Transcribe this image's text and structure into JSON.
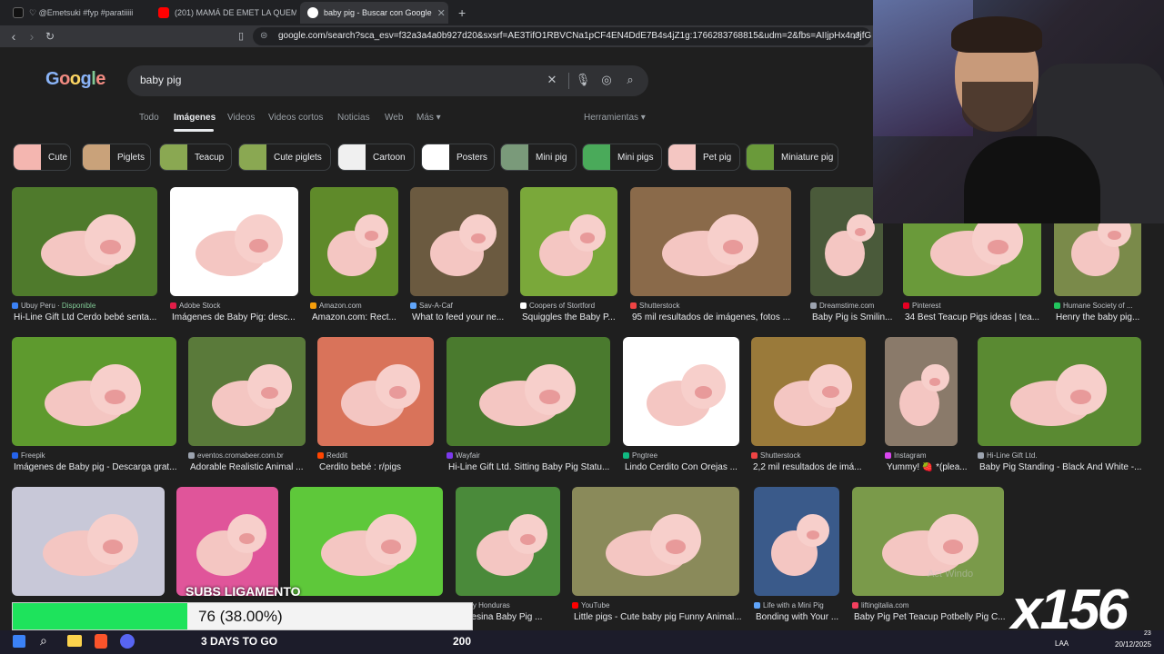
{
  "browser": {
    "tabs": [
      {
        "label": "♡ @Emetsuki #fyp #paratiiiii",
        "favicon_color": "#ffffff"
      },
      {
        "label": "(201) MAMÁ DE EMET LA QUEMA EN",
        "favicon_color": "#ff0000"
      },
      {
        "label": "baby pig - Buscar con Google",
        "favicon_color": "#ffffff",
        "active": true
      }
    ],
    "url": "google.com/search?sca_esv=f32a3a4a0b927d20&sxsrf=AE3TifO1RBVCNa1pCF4EN4DdE7B4s4jZ1g:1766283768815&udm=2&fbs=AIIjpHx4nJjfGojPV..."
  },
  "search": {
    "logo": "Google",
    "query": "baby pig"
  },
  "nav_tabs": [
    {
      "label": "Todo"
    },
    {
      "label": "Imágenes",
      "active": true
    },
    {
      "label": "Videos"
    },
    {
      "label": "Videos cortos"
    },
    {
      "label": "Noticias"
    },
    {
      "label": "Web"
    },
    {
      "label": "Más ▾"
    }
  ],
  "tools_label": "Herramientas ▾",
  "chips": [
    "Cute",
    "Piglets",
    "Teacup",
    "Cute piglets",
    "Cartoon",
    "Posters",
    "Mini pig",
    "Mini pigs",
    "Pet pig",
    "Miniature pig"
  ],
  "results": [
    {
      "source": "Ubuy Peru",
      "availability": "Disponible",
      "title": "Hi-Line Gift Ltd Cerdo bebé senta...",
      "bg": "#4f7a2c",
      "src_color": "#3b82f6"
    },
    {
      "source": "Adobe Stock",
      "title": "Imágenes de Baby Pig: desc...",
      "bg": "#ffffff",
      "src_color": "#e11d48"
    },
    {
      "source": "Amazon.com",
      "title": "Amazon.com: Rect...",
      "bg": "#5f8a2a",
      "src_color": "#f59e0b"
    },
    {
      "source": "Sav-A-Caf",
      "title": "What to feed your ne...",
      "bg": "#6b5a40",
      "src_color": "#60a5fa"
    },
    {
      "source": "Coopers of Stortford",
      "title": "Squiggles the Baby P...",
      "bg": "#7aa83a",
      "src_color": "#ffffff"
    },
    {
      "source": "Shutterstock",
      "title": "95 mil resultados de imágenes, fotos ...",
      "bg": "#8a6a4a",
      "src_color": "#ef4444"
    },
    {
      "source": "Dreamstime.com",
      "title": "Baby Pig is Smilin...",
      "bg": "#4a5a3a",
      "src_color": "#9ca3af"
    },
    {
      "source": "Pinterest",
      "title": "34 Best Teacup Pigs ideas | tea...",
      "bg": "#6a9a3a",
      "src_color": "#e60023"
    },
    {
      "source": "Humane Society of ...",
      "title": "Henry the baby pig...",
      "bg": "#7a8a4a",
      "src_color": "#22c55e"
    },
    {
      "source": "Freepik",
      "title": "Imágenes de Baby pig - Descarga grat...",
      "bg": "#5e9a2e",
      "src_color": "#2563eb"
    },
    {
      "source": "eventos.cromabeer.com.br",
      "title": "Adorable Realistic Animal ...",
      "bg": "#5a7a3a",
      "src_color": "#9ca3af"
    },
    {
      "source": "Reddit",
      "title": "Cerdito bebé : r/pigs",
      "bg": "#d9735a",
      "src_color": "#ff4500"
    },
    {
      "source": "Wayfair",
      "title": "Hi-Line Gift Ltd. Sitting Baby Pig Statu...",
      "bg": "#4a7a2e",
      "src_color": "#7c3aed"
    },
    {
      "source": "Pngtree",
      "title": "Lindo Cerdito Con Orejas ...",
      "bg": "#ffffff",
      "src_color": "#10b981"
    },
    {
      "source": "Shutterstock",
      "title": "2,2 mil resultados de imá...",
      "bg": "#9a7a3a",
      "src_color": "#ef4444"
    },
    {
      "source": "Instagram",
      "title": "Yummy! 🍓 *(plea...",
      "bg": "#8a7a6a",
      "src_color": "#d946ef"
    },
    {
      "source": "Hi-Line Gift Ltd.",
      "title": "Baby Pig Standing - Black And White -...",
      "bg": "#5a8a32",
      "src_color": "#9ca3af"
    },
    {
      "source": "",
      "title": "",
      "bg": "#c8c8d8",
      "src_color": "#9ca3af"
    },
    {
      "source": "",
      "title": "",
      "bg": "#e0559a",
      "src_color": "#9ca3af"
    },
    {
      "source": "",
      "title": "",
      "bg": "#5ec83a",
      "src_color": "#9ca3af"
    },
    {
      "source": "buy Honduras",
      "title": "a Resina Baby Pig ...",
      "bg": "#4a8a3a",
      "src_color": "#3b82f6"
    },
    {
      "source": "YouTube",
      "title": "Little pigs - Cute baby pig Funny Animal...",
      "bg": "#8a8a5a",
      "src_color": "#ff0000"
    },
    {
      "source": "Life with a Mini Pig",
      "title": "Bonding with Your ...",
      "bg": "#3a5a8a",
      "src_color": "#60a5fa"
    },
    {
      "source": "liftingitalia.com",
      "title": "Baby Pig Pet Teacup Potbelly Pig C...",
      "bg": "#7a9a4a",
      "src_color": "#f43f5e"
    }
  ],
  "overlay": {
    "subs_label": "SUBS LIGAMENTO",
    "subs_value": "76 (38.00%)",
    "subs_fraction": 0.38,
    "days_label": "3 DAYS TO GO",
    "goal": "200",
    "multiplier": "x156"
  },
  "system": {
    "lang": "LAA",
    "time": "23",
    "date": "20/12/2025",
    "watermark": "Act Windo"
  }
}
